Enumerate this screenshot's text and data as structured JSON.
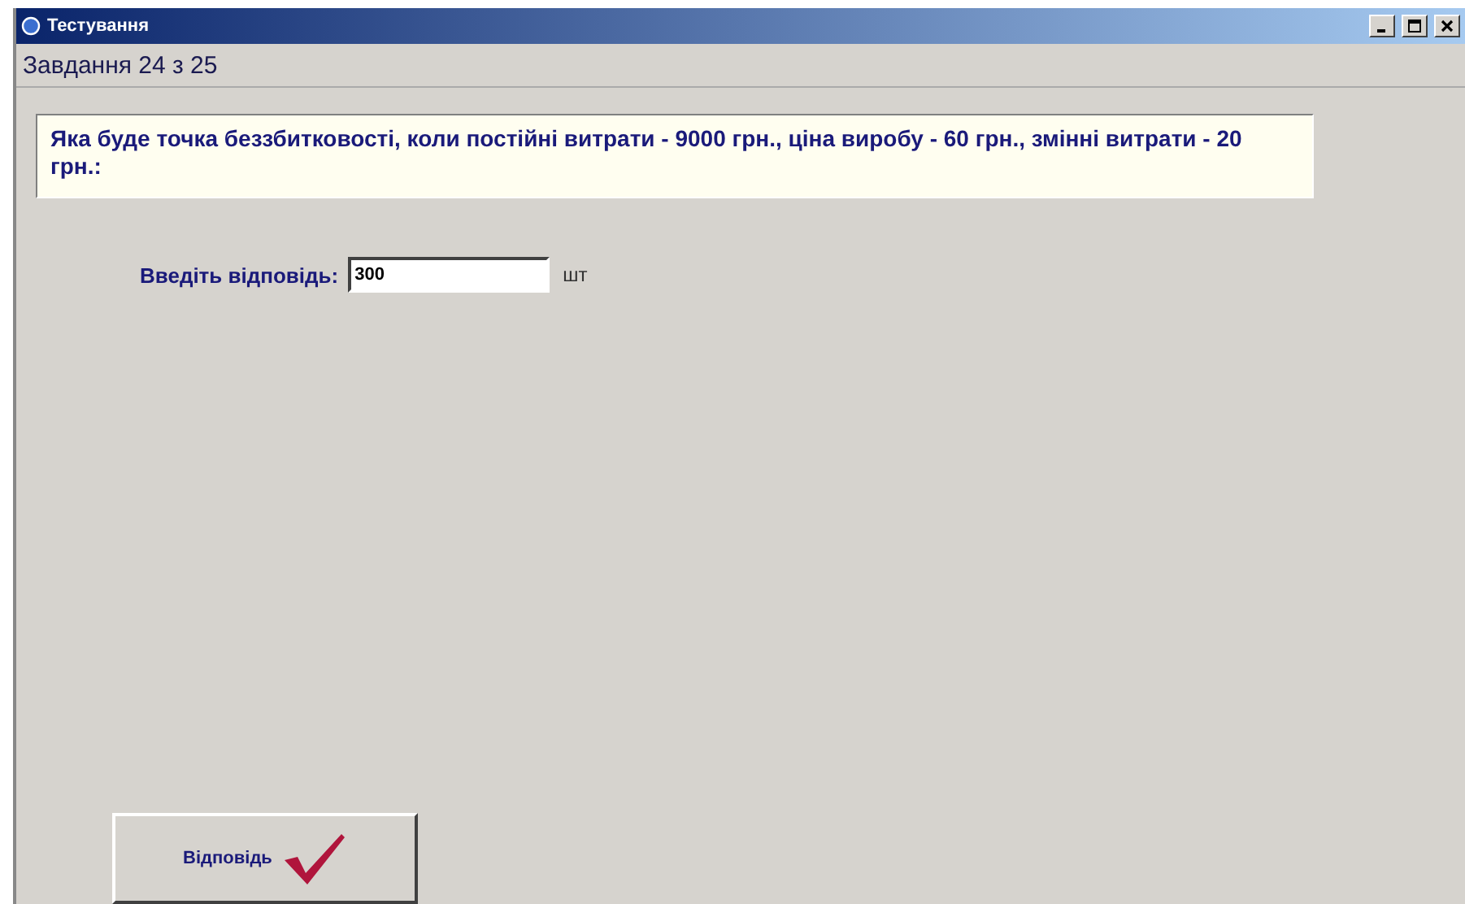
{
  "window": {
    "title": "Тестування"
  },
  "header": "Завдання 24 з 25",
  "question": "Яка буде точка беззбитковості, коли постійні витрати - 9000 грн., ціна виробу - 60 грн., змінні витрати - 20 грн.:",
  "answer": {
    "label": "Введіть відповідь:",
    "value": "300",
    "unit": "шт"
  },
  "buttons": [
    {
      "label": "Відповідь"
    }
  ]
}
